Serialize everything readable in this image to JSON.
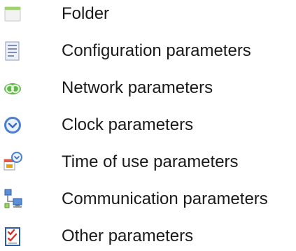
{
  "items": [
    {
      "label": "Folder",
      "icon": "folder-icon"
    },
    {
      "label": "Configuration parameters",
      "icon": "configuration-document-icon"
    },
    {
      "label": "Network parameters",
      "icon": "network-rings-icon"
    },
    {
      "label": "Clock parameters",
      "icon": "clock-icon"
    },
    {
      "label": "Time of use parameters",
      "icon": "calendar-clock-icon"
    },
    {
      "label": "Communication parameters",
      "icon": "communication-computers-icon"
    },
    {
      "label": "Other parameters",
      "icon": "checklist-icon"
    }
  ]
}
